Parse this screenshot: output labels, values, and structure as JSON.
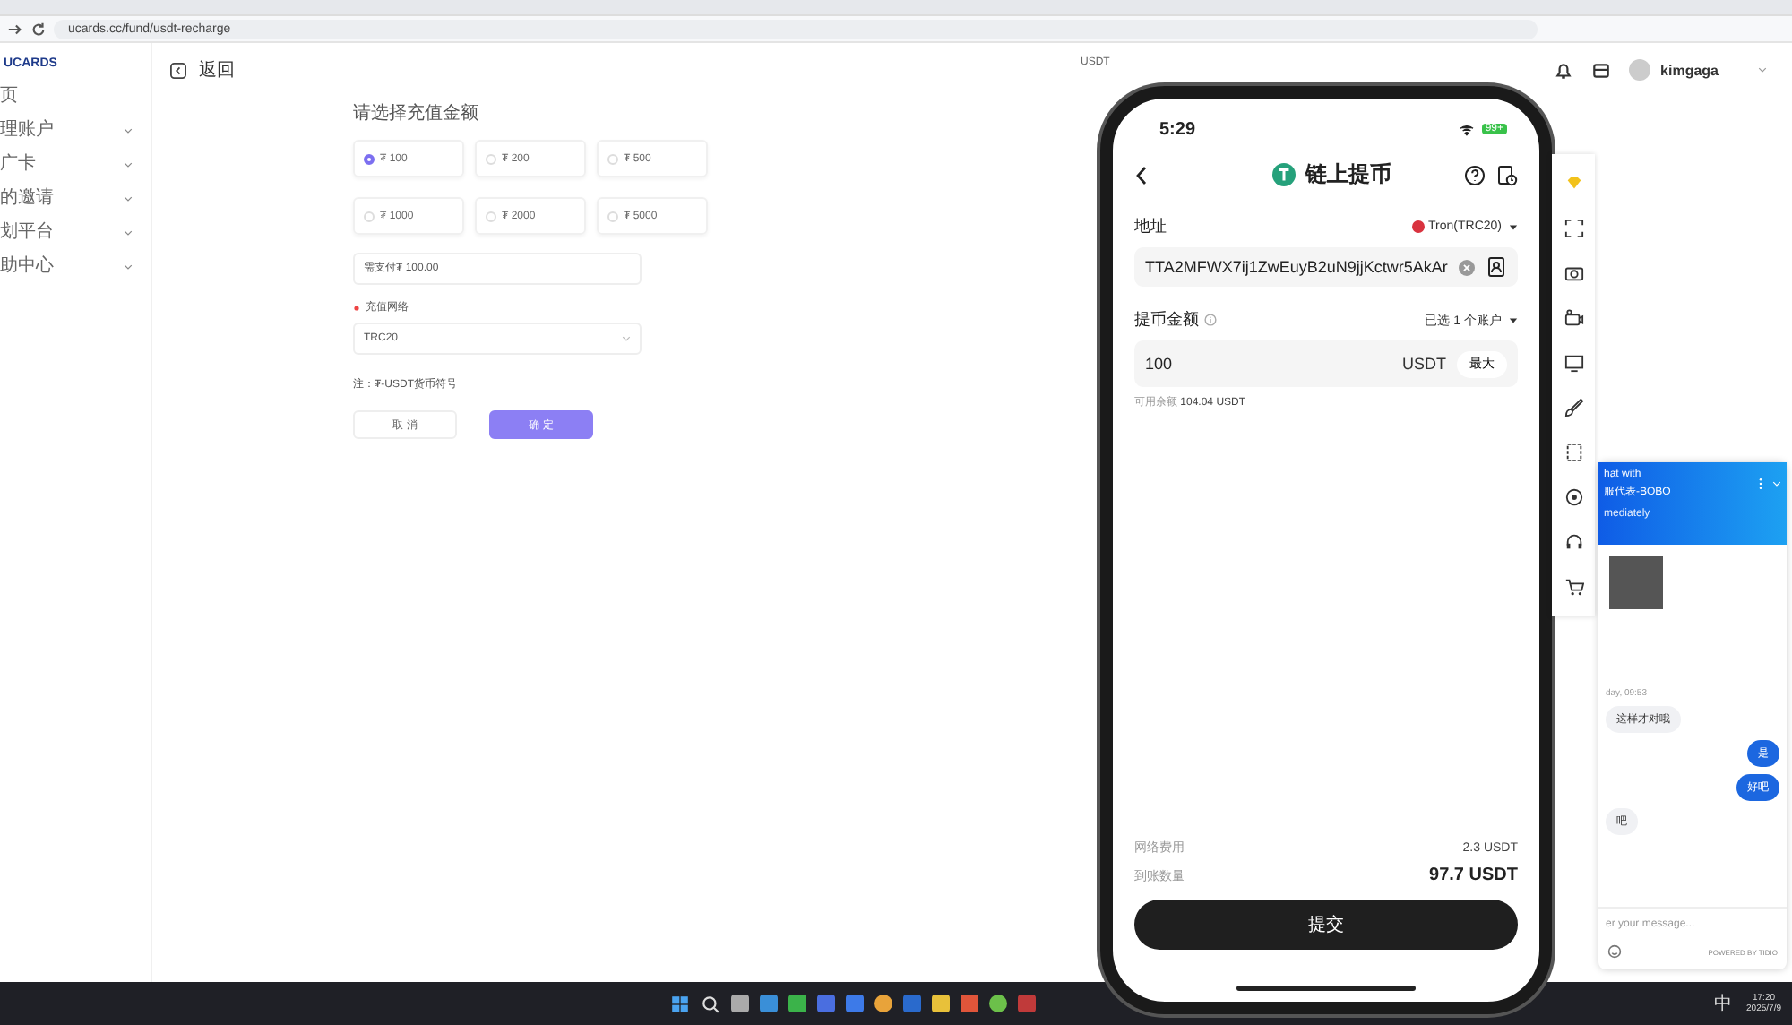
{
  "browser": {
    "address": "ucards.cc/fund/usdt-recharge"
  },
  "sidebar": {
    "logo": "UCARDS",
    "items": [
      {
        "label": "页",
        "expandable": false
      },
      {
        "label": "理账户",
        "expandable": true
      },
      {
        "label": "广卡",
        "expandable": true
      },
      {
        "label": "的邀请",
        "expandable": true
      },
      {
        "label": "划平台",
        "expandable": true
      },
      {
        "label": "助中心",
        "expandable": true
      }
    ]
  },
  "header": {
    "back": "返回",
    "user": "kimgaga"
  },
  "form": {
    "amount_label": "请选择充值金额",
    "amounts": [
      {
        "label": "₮ 100",
        "selected": true
      },
      {
        "label": "₮ 200",
        "selected": false
      },
      {
        "label": "₮ 500",
        "selected": false
      },
      {
        "label": "₮ 1000",
        "selected": false
      },
      {
        "label": "₮ 2000",
        "selected": false
      },
      {
        "label": "₮ 5000",
        "selected": false
      }
    ],
    "pay_value": "需支付₮ 100.00",
    "network_label": "充值网络",
    "network_required": true,
    "network_value": "TRC20",
    "note": "注：₮-USDT货币符号",
    "buttons": [
      {
        "label": "取 消",
        "kind": "secondary"
      },
      {
        "label": "确 定",
        "kind": "primary"
      }
    ],
    "side_text": "USDT"
  },
  "phone": {
    "time": "5:29",
    "battery": "99+",
    "title": "链上提币",
    "address_label": "地址",
    "network": "Tron(TRC20)",
    "address": "TTA2MFWX7ij1ZwEuyB2uN9jjKctwr5AkAr",
    "amount_label": "提币金额",
    "accounts": "已选 1 个账户",
    "amount": "100",
    "unit": "USDT",
    "max": "最大",
    "balance_label": "可用余额",
    "balance": "104.04 USDT",
    "fee_label": "网络费用",
    "fee": "2.3 USDT",
    "receive_label": "到账数量",
    "receive": "97.7 USDT",
    "submit": "提交"
  },
  "chat": {
    "title": "hat with",
    "agent": "服代表-BOBO",
    "status": "mediately",
    "timestamp": "day, 09:53",
    "messages": [
      {
        "text": "这样才对哦",
        "kind": "agent"
      },
      {
        "text": "是",
        "kind": "user"
      },
      {
        "text": "好吧",
        "kind": "user"
      },
      {
        "text": "吧",
        "kind": "agent"
      }
    ],
    "placeholder": "er your message...",
    "powered": "POWERED BY TIDIO"
  },
  "taskbar": {
    "ime": "中",
    "time": "17:20",
    "date": "2025/7/9"
  }
}
